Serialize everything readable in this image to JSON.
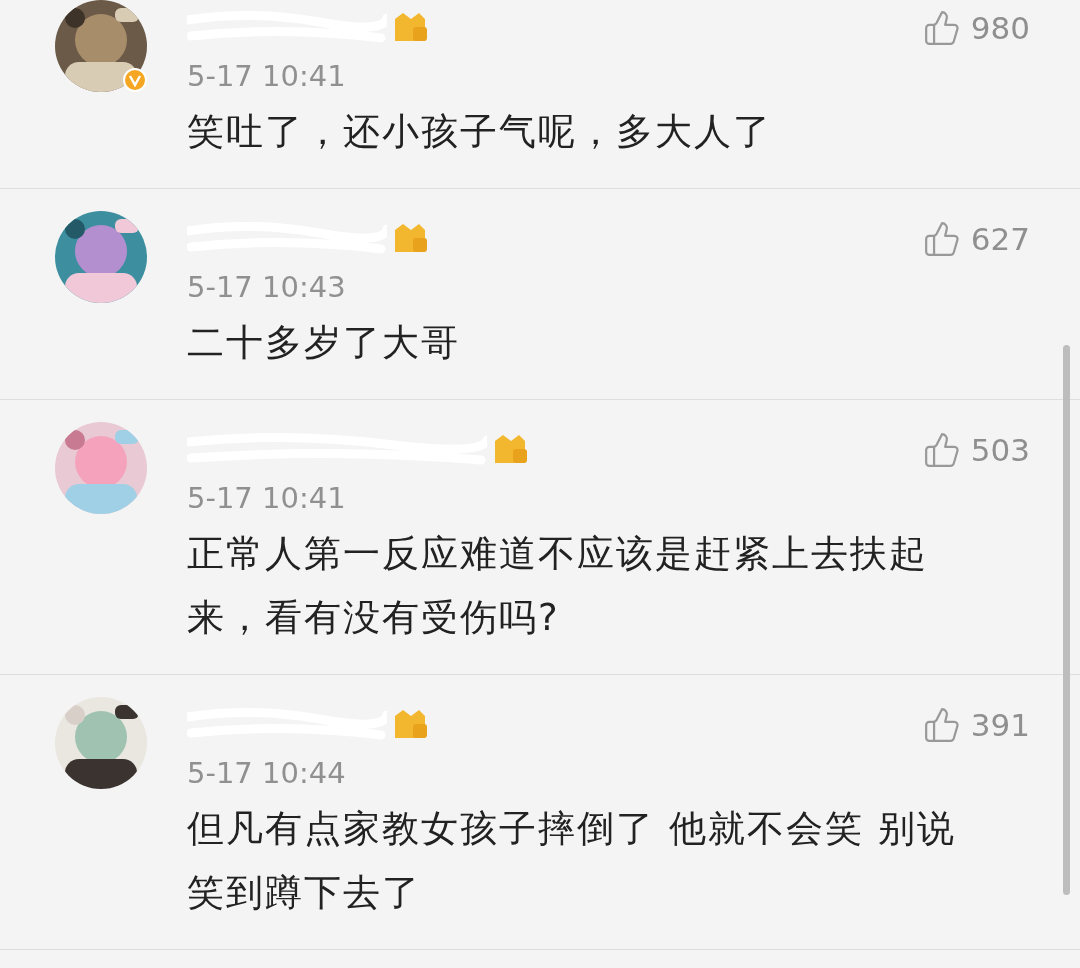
{
  "comments": [
    {
      "time": "5-17 10:41",
      "likes": "980",
      "verified": true,
      "lines": [
        "笑吐了，还小孩子气呢，多大人了"
      ]
    },
    {
      "time": "5-17 10:43",
      "likes": "627",
      "verified": false,
      "lines": [
        "二十多岁了大哥"
      ]
    },
    {
      "time": "5-17 10:41",
      "likes": "503",
      "verified": false,
      "lines": [
        "正常人第一反应难道不应该是赶紧上去扶起",
        "来，看有没有受伤吗?"
      ]
    },
    {
      "time": "5-17 10:44",
      "likes": "391",
      "verified": false,
      "lines": [
        "但凡有点家教女孩子摔倒了 他就不会笑 别说",
        "笑到蹲下去了"
      ]
    }
  ]
}
